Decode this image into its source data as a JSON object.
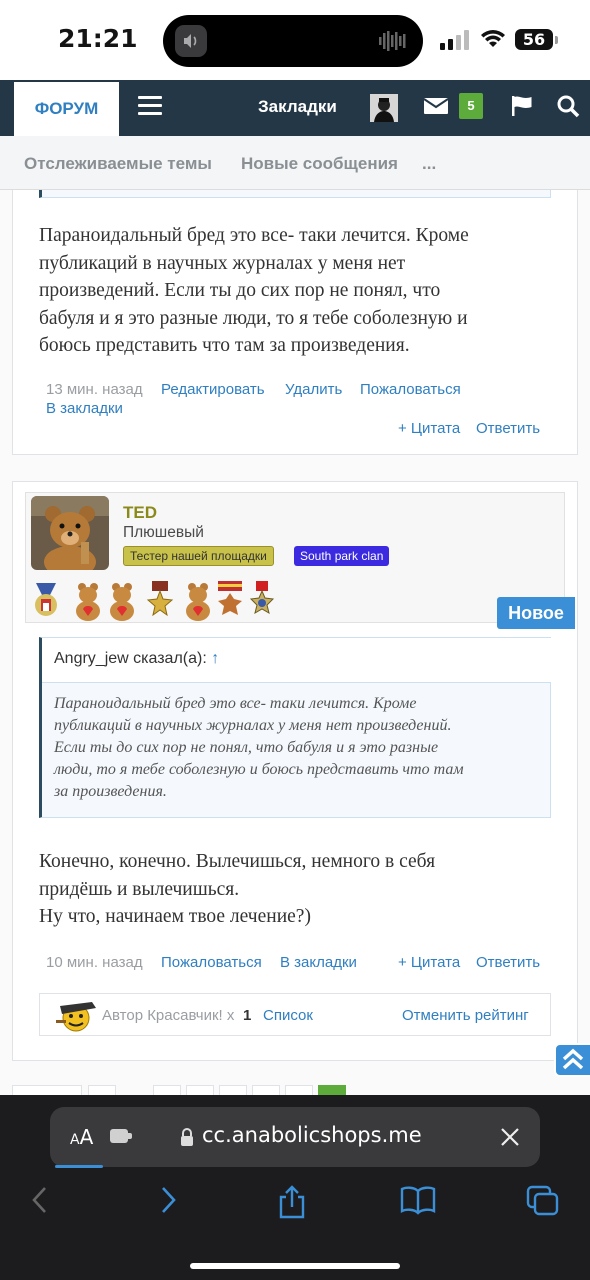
{
  "status_bar": {
    "time": "21:21",
    "battery": "56"
  },
  "navbar": {
    "forum_tab": "ФОРУМ",
    "bookmarks": "Закладки",
    "inbox_count": "5"
  },
  "subnav": {
    "items": [
      "Отслеживаемые темы",
      "Новые сообщения",
      "..."
    ]
  },
  "previous_post": {
    "text_lines": [
      "Параноидальный бред это все- таки лечится. Кроме",
      "публикаций в научных журналах у меня нет",
      "произведений. Если ты до сих пор не понял, что",
      "бабуля и я это разные люди, то я тебе соболезную и",
      "боюсь представить что там за произведения."
    ],
    "time": "13 мин. назад",
    "actions": {
      "edit": "Редактировать",
      "delete": "Удалить",
      "report": "Пожаловаться",
      "bookmark": "В закладки",
      "quote": "+ Цитата",
      "reply": "Ответить"
    }
  },
  "post": {
    "author": {
      "name": "TED",
      "title": "Плюшевый",
      "badges": [
        "Тестер нашей площадки",
        "South park clan"
      ]
    },
    "new_label": "Новое",
    "quote": {
      "header": "Angry_jew сказал(а):",
      "arrow": "↑",
      "lines": [
        "Параноидальный бред это все- таки лечится. Кроме",
        "публикаций в научных журналах у меня нет произведений.",
        "Если ты до сих пор не понял, что бабуля и я это разные",
        "люди, то я тебе соболезную и боюсь представить что там",
        "за произведения."
      ]
    },
    "text_lines": [
      "Конечно, конечно. Вылечишься, немного в себя",
      "придёшь и вылечишься.",
      "Ну что, начинаем твое лечение?)"
    ],
    "time": "10 мин. назад",
    "actions": {
      "report": "Пожаловаться",
      "bookmark": "В закладки",
      "quote": "+ Цитата",
      "reply": "Ответить"
    },
    "rating": {
      "label": "Автор Красавчик! x",
      "count": "1",
      "list": "Список",
      "cancel": "Отменить рейтинг"
    }
  },
  "safari": {
    "aa": "A",
    "aa_big": "A",
    "url": "cc.anabolicshops.me"
  },
  "colors": {
    "navbar": "#243747",
    "link": "#2f7fc1",
    "new_badge": "#3a8fd6",
    "inbox_badge": "#5dab3a"
  }
}
